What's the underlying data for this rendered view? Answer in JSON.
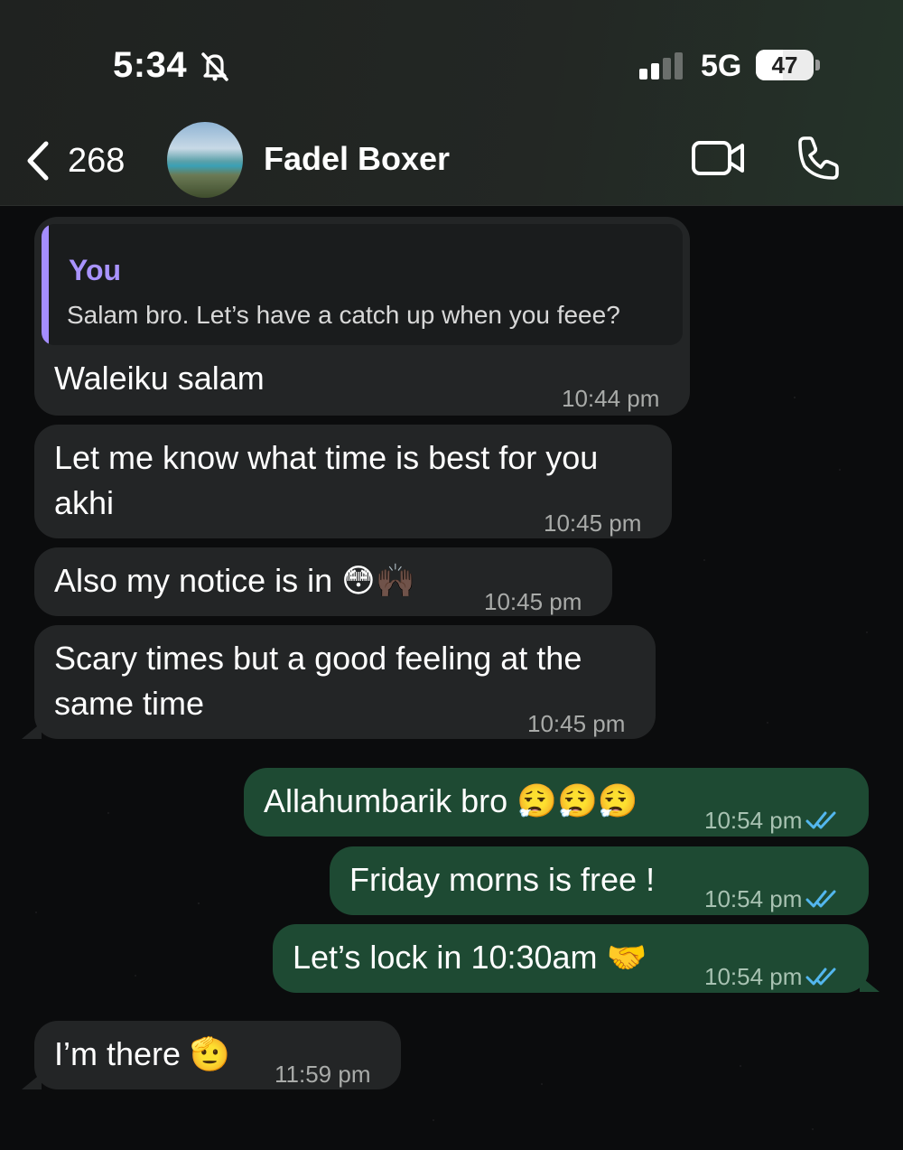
{
  "status_bar": {
    "time": "5:34",
    "network": "5G",
    "battery": "47",
    "battery_level_percent": 47
  },
  "header": {
    "unread_count": "268",
    "contact_name": "Fadel Boxer"
  },
  "icons": {
    "back": "chevron-left-icon",
    "muted": "bell-slash-icon",
    "video": "video-camera-icon",
    "call": "phone-icon",
    "read": "double-check-icon"
  },
  "colors": {
    "incoming_bubble": "#232526",
    "outgoing_bubble": "#1e4a33",
    "quote_accent": "#a48dff",
    "read_ticks": "#53b7ee"
  },
  "messages": [
    {
      "direction": "in",
      "reply_to": {
        "author": "You",
        "text": "Salam bro. Let’s have a catch up when you feee?"
      },
      "lines": [
        "Waleiku salam"
      ],
      "time": "10:44 pm"
    },
    {
      "direction": "in",
      "lines": [
        "Let me know what time is best for you",
        "akhi"
      ],
      "time": "10:45 pm"
    },
    {
      "direction": "in",
      "lines": [
        "Also my notice is in 😳🙌🏿"
      ],
      "time": "10:45 pm"
    },
    {
      "direction": "in",
      "lines": [
        "Scary times but a good feeling at the",
        "same time"
      ],
      "time": "10:45 pm"
    },
    {
      "direction": "out",
      "lines": [
        "Allahumbarik bro 😮‍💨😮‍💨😮‍💨"
      ],
      "time": "10:54 pm",
      "read": true
    },
    {
      "direction": "out",
      "lines": [
        "Friday morns is free !"
      ],
      "time": "10:54 pm",
      "read": true
    },
    {
      "direction": "out",
      "lines": [
        "Let’s lock in 10:30am 🤝"
      ],
      "time": "10:54 pm",
      "read": true
    },
    {
      "direction": "in",
      "lines": [
        "I’m there 🫡"
      ],
      "time": "11:59 pm"
    }
  ]
}
